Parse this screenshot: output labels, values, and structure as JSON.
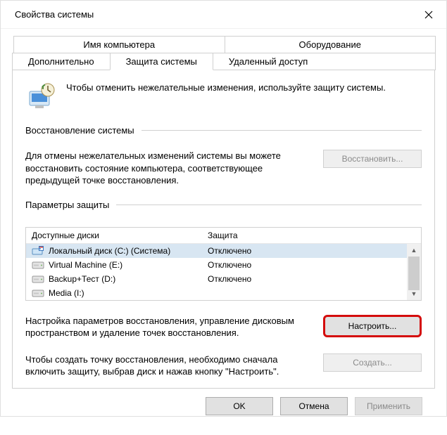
{
  "window": {
    "title": "Свойства системы"
  },
  "tabs": {
    "row1": [
      "Имя компьютера",
      "Оборудование"
    ],
    "row2": [
      "Дополнительно",
      "Защита системы",
      "Удаленный доступ"
    ],
    "active": "Защита системы"
  },
  "intro": "Чтобы отменить нежелательные изменения, используйте защиту системы.",
  "restore": {
    "heading": "Восстановление системы",
    "text": "Для отмены нежелательных изменений системы вы можете восстановить состояние компьютера, соответствующее предыдущей точке восстановления.",
    "button": "Восстановить..."
  },
  "protection": {
    "heading": "Параметры защиты",
    "columns": {
      "c1": "Доступные диски",
      "c2": "Защита"
    },
    "rows": [
      {
        "name": "Локальный диск (C:) (Система)",
        "prot": "Отключено",
        "icon": "system",
        "selected": true
      },
      {
        "name": "Virtual Machine (E:)",
        "prot": "Отключено",
        "icon": "drive",
        "selected": false
      },
      {
        "name": "Backup+Тест (D:)",
        "prot": "Отключено",
        "icon": "drive",
        "selected": false
      },
      {
        "name": "Media (I:)",
        "prot": "",
        "icon": "drive",
        "selected": false
      }
    ]
  },
  "configure": {
    "text": "Настройка параметров восстановления, управление дисковым пространством и удаление точек восстановления.",
    "button": "Настроить..."
  },
  "create": {
    "text": "Чтобы создать точку восстановления, необходимо сначала включить защиту, выбрав диск и нажав кнопку \"Настроить\".",
    "button": "Создать..."
  },
  "footer": {
    "ok": "OK",
    "cancel": "Отмена",
    "apply": "Применить"
  }
}
